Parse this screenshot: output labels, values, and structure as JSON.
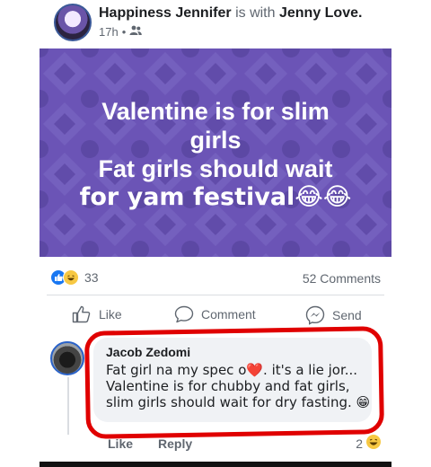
{
  "post": {
    "author": "Happiness Jennifer",
    "with_text": "is with",
    "tagged": "Jenny Love.",
    "time": "17h",
    "audience_icon": "friends-icon",
    "image_text_lines": [
      "Valentine is for slim",
      "girls",
      "Fat girls should wait",
      "for yam festival😂😂"
    ],
    "image_bg_color": "#6b54b6",
    "reaction_count": "33",
    "comments_count": "52 Comments"
  },
  "actions": {
    "like": "Like",
    "comment": "Comment",
    "send": "Send"
  },
  "comment": {
    "author": "Jacob Zedomi",
    "text": "Fat girl na my spec o❤️. it's a lie jor... Valentine is for chubby and fat girls, slim girls should wait for dry fasting. 😁",
    "like_label": "Like",
    "reply_label": "Reply",
    "reaction_count": "2",
    "highlight_color": "#e00000"
  }
}
